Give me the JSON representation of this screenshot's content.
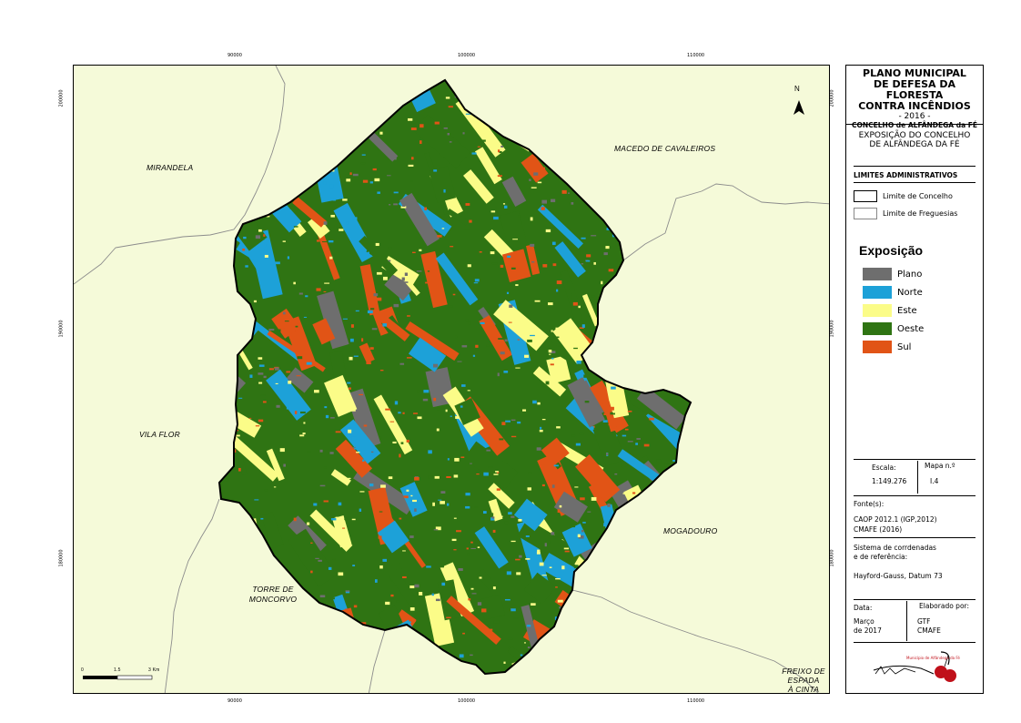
{
  "coords": {
    "top": [
      "90000",
      "100000",
      "110000"
    ],
    "bottom": [
      "90000",
      "100000",
      "110000"
    ],
    "left": [
      "200000",
      "190000",
      "180000"
    ],
    "right": [
      "200000",
      "190000",
      "180000"
    ]
  },
  "map": {
    "north_label": "N",
    "place_names": {
      "mirandela": "MIRANDELA",
      "macedo": "MACEDO DE CAVALEIROS",
      "vila_flor": "VILA FLOR",
      "mogadouro": "MOGADOURO",
      "torre_1": "TORRE DE",
      "torre_2": "MONCORVO",
      "freixo_1": "FREIXO DE",
      "freixo_2": "ESPADA",
      "freixo_3": "À CINTA"
    },
    "scalebar": {
      "t0": "0",
      "t1": "1.5",
      "t2": "3 Km"
    },
    "colors": {
      "background": "#f5fad9",
      "plano": "#6e6e6e",
      "norte": "#1da1d8",
      "este": "#fbfc88",
      "oeste": "#2f7413",
      "sul": "#e15416"
    }
  },
  "panel": {
    "title": [
      "PLANO MUNICIPAL",
      "DE DEFESA DA FLORESTA",
      "CONTRA INCÊNDIOS"
    ],
    "year": "- 2016 -",
    "municipality": "CONCELHO de ALFÂNDEGA da FÉ",
    "map_title": [
      "EXPOSIÇÃO DO CONCELHO",
      "DE ALFÂNDEGA DA FÉ"
    ],
    "admin_heading": "LIMITES ADMINISTRATIVOS",
    "admin_items": [
      "Limite de Concelho",
      "Limite de Freguesias"
    ],
    "legend_heading": "Exposição",
    "legend_items": [
      {
        "label": "Plano",
        "color": "#6e6e6e"
      },
      {
        "label": "Norte",
        "color": "#1da1d8"
      },
      {
        "label": "Este",
        "color": "#fbfc88"
      },
      {
        "label": "Oeste",
        "color": "#2f7413"
      },
      {
        "label": "Sul",
        "color": "#e15416"
      }
    ],
    "scale_label": "Escala:",
    "scale_value": "1:149.276",
    "map_no_label": "Mapa n.º",
    "map_no_value": "I.4",
    "sources_label": "Fonte(s):",
    "sources": [
      "CAOP 2012.1 (IGP,2012)",
      "CMAFE (2016)"
    ],
    "crs_label": [
      "Sistema de corrdenadas",
      "e de referência:"
    ],
    "crs_value": "Hayford-Gauss, Datum 73",
    "date_label": "Data:",
    "date_value": [
      "Março",
      "de 2017"
    ],
    "author_label": "Elaborado por:",
    "author_value": [
      "GTF",
      "CMAFE"
    ],
    "logo_text": "Município de Alfândega da Fé"
  }
}
